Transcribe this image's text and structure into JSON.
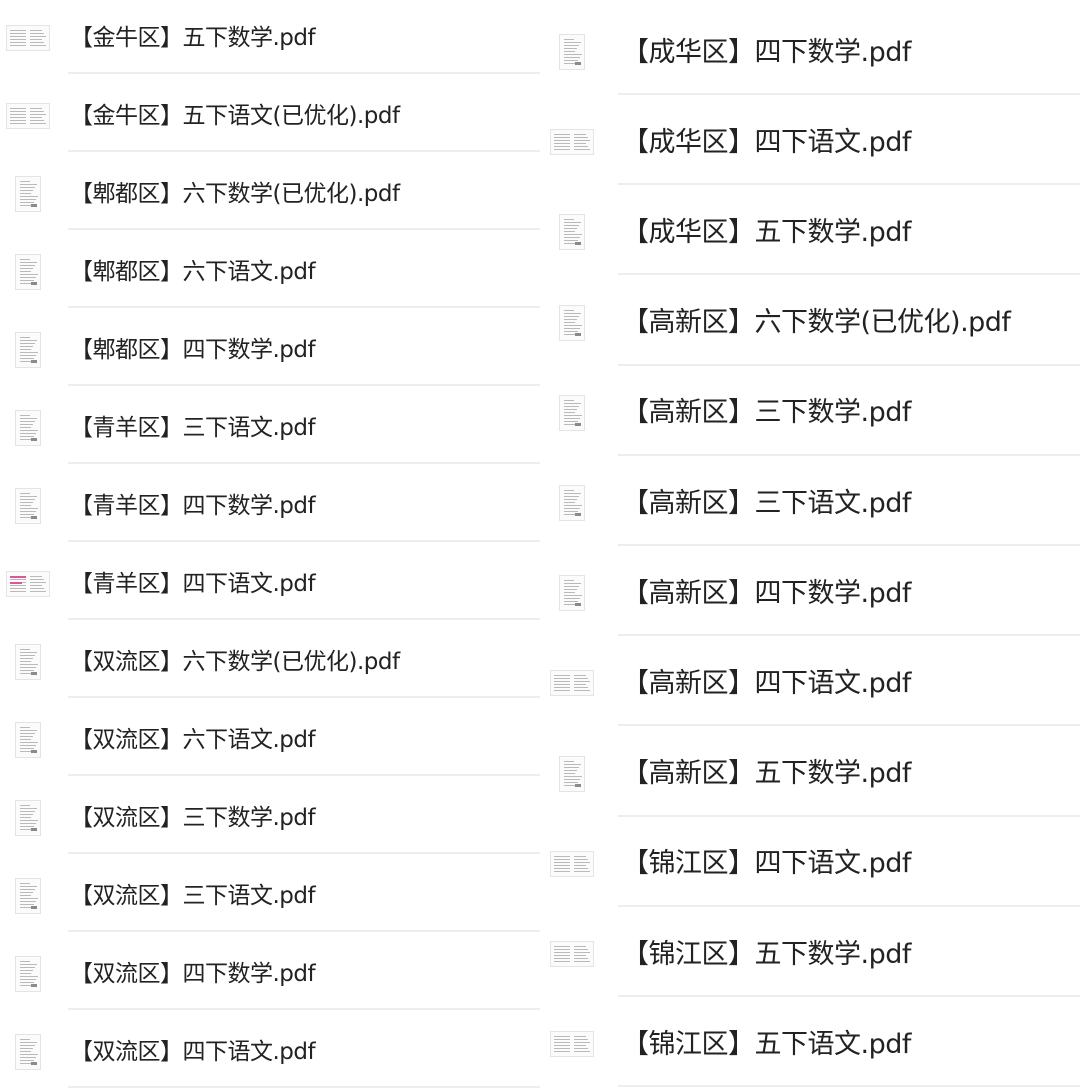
{
  "file_list": {
    "left_column": [
      {
        "name": "【金牛区】五下数学.pdf",
        "thumb": "landscape"
      },
      {
        "name": "【金牛区】五下语文(已优化).pdf",
        "thumb": "landscape"
      },
      {
        "name": "【郫都区】六下数学(已优化).pdf",
        "thumb": "portrait"
      },
      {
        "name": "【郫都区】六下语文.pdf",
        "thumb": "portrait"
      },
      {
        "name": "【郫都区】四下数学.pdf",
        "thumb": "portrait"
      },
      {
        "name": "【青羊区】三下语文.pdf",
        "thumb": "portrait"
      },
      {
        "name": "【青羊区】四下数学.pdf",
        "thumb": "portrait"
      },
      {
        "name": "【青羊区】四下语文.pdf",
        "thumb": "landscape",
        "accent": true
      },
      {
        "name": "【双流区】六下数学(已优化).pdf",
        "thumb": "portrait"
      },
      {
        "name": "【双流区】六下语文.pdf",
        "thumb": "portrait"
      },
      {
        "name": "【双流区】三下数学.pdf",
        "thumb": "portrait"
      },
      {
        "name": "【双流区】三下语文.pdf",
        "thumb": "portrait"
      },
      {
        "name": "【双流区】四下数学.pdf",
        "thumb": "portrait"
      },
      {
        "name": "【双流区】四下语文.pdf",
        "thumb": "portrait"
      }
    ],
    "right_column": [
      {
        "name": "【成华区】四下数学.pdf",
        "thumb": "portrait"
      },
      {
        "name": "【成华区】四下语文.pdf",
        "thumb": "landscape"
      },
      {
        "name": "【成华区】五下数学.pdf",
        "thumb": "portrait"
      },
      {
        "name": "【高新区】六下数学(已优化).pdf",
        "thumb": "portrait"
      },
      {
        "name": "【高新区】三下数学.pdf",
        "thumb": "portrait"
      },
      {
        "name": "【高新区】三下语文.pdf",
        "thumb": "portrait"
      },
      {
        "name": "【高新区】四下数学.pdf",
        "thumb": "portrait"
      },
      {
        "name": "【高新区】四下语文.pdf",
        "thumb": "landscape"
      },
      {
        "name": "【高新区】五下数学.pdf",
        "thumb": "portrait"
      },
      {
        "name": "【锦江区】四下语文.pdf",
        "thumb": "landscape"
      },
      {
        "name": "【锦江区】五下数学.pdf",
        "thumb": "landscape"
      },
      {
        "name": "【锦江区】五下语文.pdf",
        "thumb": "landscape"
      }
    ],
    "file_icon": "pdf-page-thumbnail",
    "accent_color": "#e0569a",
    "divider_color": "#ededed"
  }
}
